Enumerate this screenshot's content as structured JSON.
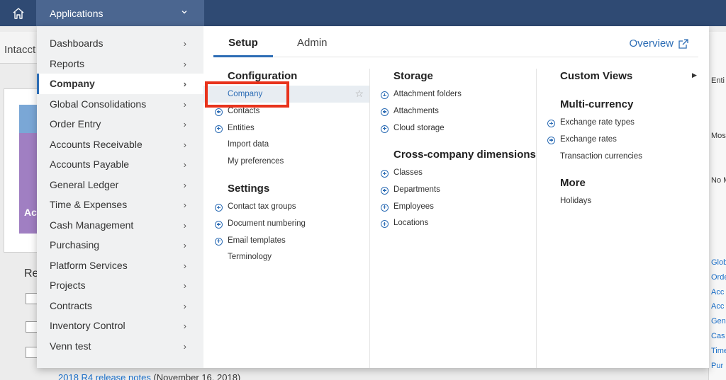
{
  "topbar": {
    "home_icon": "home-icon",
    "apps_label": "Applications"
  },
  "background": {
    "page_title": "Intacct",
    "banner_text": "Ac",
    "recent_heading": "Re",
    "release_link_text": "2018 R4 release notes",
    "release_link_suffix": " (November 16, 2018)",
    "right_texts": [
      "Enti",
      "Mos",
      "No M"
    ],
    "right_links": [
      "Glob",
      "Orde",
      "Acc",
      "Acc",
      "Gen",
      "Cas",
      "Time",
      "Pur"
    ]
  },
  "left_menu": [
    {
      "label": "Dashboards",
      "active": false
    },
    {
      "label": "Reports",
      "active": false
    },
    {
      "label": "Company",
      "active": true
    },
    {
      "label": "Global Consolidations",
      "active": false
    },
    {
      "label": "Order Entry",
      "active": false
    },
    {
      "label": "Accounts Receivable",
      "active": false
    },
    {
      "label": "Accounts Payable",
      "active": false
    },
    {
      "label": "General Ledger",
      "active": false
    },
    {
      "label": "Time & Expenses",
      "active": false
    },
    {
      "label": "Cash Management",
      "active": false
    },
    {
      "label": "Purchasing",
      "active": false
    },
    {
      "label": "Platform Services",
      "active": false
    },
    {
      "label": "Projects",
      "active": false
    },
    {
      "label": "Contracts",
      "active": false
    },
    {
      "label": "Inventory Control",
      "active": false
    },
    {
      "label": "Venn test",
      "active": false
    }
  ],
  "tabs": [
    {
      "label": "Setup",
      "selected": true
    },
    {
      "label": "Admin",
      "selected": false
    }
  ],
  "overview_label": "Overview",
  "col1": {
    "configuration": {
      "heading": "Configuration",
      "items": [
        {
          "label": "Company",
          "plus": false,
          "highlighted": true
        },
        {
          "label": "Contacts",
          "plus": true
        },
        {
          "label": "Entities",
          "plus": true
        },
        {
          "label": "Import data",
          "plus": false
        },
        {
          "label": "My preferences",
          "plus": false
        }
      ]
    },
    "settings": {
      "heading": "Settings",
      "items": [
        {
          "label": "Contact tax groups",
          "plus": true
        },
        {
          "label": "Document numbering",
          "plus": true
        },
        {
          "label": "Email templates",
          "plus": true
        },
        {
          "label": "Terminology",
          "plus": false
        }
      ]
    }
  },
  "col2": {
    "storage": {
      "heading": "Storage",
      "items": [
        {
          "label": "Attachment folders",
          "plus": true
        },
        {
          "label": "Attachments",
          "plus": true
        },
        {
          "label": "Cloud storage",
          "plus": true
        }
      ]
    },
    "dimensions": {
      "heading": "Cross-company dimensions",
      "items": [
        {
          "label": "Classes",
          "plus": true
        },
        {
          "label": "Departments",
          "plus": true
        },
        {
          "label": "Employees",
          "plus": true
        },
        {
          "label": "Locations",
          "plus": true
        }
      ]
    }
  },
  "col3": {
    "custom_views": {
      "heading": "Custom Views"
    },
    "multi_currency": {
      "heading": "Multi-currency",
      "items": [
        {
          "label": "Exchange rate types",
          "plus": true
        },
        {
          "label": "Exchange rates",
          "plus": true
        },
        {
          "label": "Transaction currencies",
          "plus": false
        }
      ]
    },
    "more": {
      "heading": "More",
      "items": [
        {
          "label": "Holidays",
          "plus": false
        }
      ]
    }
  },
  "colors": {
    "topbar": "#2f4a73",
    "accent": "#2d6db5",
    "highlight_box": "#e8331c"
  }
}
